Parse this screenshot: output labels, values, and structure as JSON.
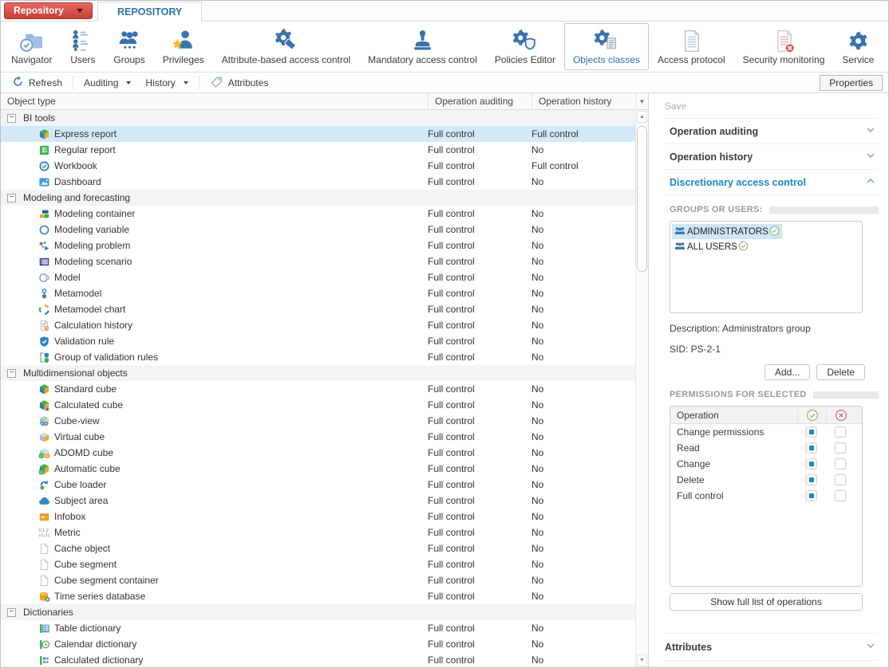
{
  "titlebar": {
    "app_menu": "Repository",
    "tab": "REPOSITORY"
  },
  "ribbon": {
    "items": [
      {
        "label": "Navigator",
        "icon": "navigator",
        "selected": false
      },
      {
        "label": "Users",
        "icon": "users",
        "selected": false
      },
      {
        "label": "Groups",
        "icon": "groups",
        "selected": false
      },
      {
        "label": "Privileges",
        "icon": "privileges",
        "selected": false
      },
      {
        "label": "Attribute-based access control",
        "icon": "abac",
        "selected": false
      },
      {
        "label": "Mandatory access control",
        "icon": "mac",
        "selected": false
      },
      {
        "label": "Policies Editor",
        "icon": "policies-editor",
        "selected": false
      },
      {
        "label": "Objects classes",
        "icon": "objects-classes",
        "selected": true
      },
      {
        "label": "Access protocol",
        "icon": "access-protocol",
        "selected": false
      },
      {
        "label": "Security monitoring",
        "icon": "security-monitoring",
        "selected": false
      },
      {
        "label": "Service",
        "icon": "service",
        "selected": false
      }
    ]
  },
  "toolbar": {
    "refresh": "Refresh",
    "auditing": "Auditing",
    "history": "History",
    "attributes": "Attributes",
    "properties": "Properties"
  },
  "table": {
    "columns": [
      "Object type",
      "Operation auditing",
      "Operation history"
    ],
    "rows": [
      {
        "type": "group",
        "label": "BI tools"
      },
      {
        "type": "item",
        "icon": "express-report",
        "label": "Express report",
        "auditing": "Full control",
        "history": "Full control",
        "selected": true
      },
      {
        "type": "item",
        "icon": "regular-report",
        "label": "Regular report",
        "auditing": "Full control",
        "history": "No"
      },
      {
        "type": "item",
        "icon": "workbook",
        "label": "Workbook",
        "auditing": "Full control",
        "history": "Full control"
      },
      {
        "type": "item",
        "icon": "dashboard",
        "label": "Dashboard",
        "auditing": "Full control",
        "history": "No"
      },
      {
        "type": "group",
        "label": "Modeling and forecasting"
      },
      {
        "type": "item",
        "icon": "modeling-container",
        "label": "Modeling container",
        "auditing": "Full control",
        "history": "No"
      },
      {
        "type": "item",
        "icon": "modeling-variable",
        "label": "Modeling variable",
        "auditing": "Full control",
        "history": "No"
      },
      {
        "type": "item",
        "icon": "modeling-problem",
        "label": "Modeling problem",
        "auditing": "Full control",
        "history": "No"
      },
      {
        "type": "item",
        "icon": "modeling-scenario",
        "label": "Modeling scenario",
        "auditing": "Full control",
        "history": "No"
      },
      {
        "type": "item",
        "icon": "model",
        "label": "Model",
        "auditing": "Full control",
        "history": "No"
      },
      {
        "type": "item",
        "icon": "metamodel",
        "label": "Metamodel",
        "auditing": "Full control",
        "history": "No"
      },
      {
        "type": "item",
        "icon": "metamodel-chart",
        "label": "Metamodel chart",
        "auditing": "Full control",
        "history": "No"
      },
      {
        "type": "item",
        "icon": "calculation-history",
        "label": "Calculation history",
        "auditing": "Full control",
        "history": "No"
      },
      {
        "type": "item",
        "icon": "validation-rule",
        "label": "Validation rule",
        "auditing": "Full control",
        "history": "No"
      },
      {
        "type": "item",
        "icon": "group-validation-rules",
        "label": "Group of validation rules",
        "auditing": "Full control",
        "history": "No"
      },
      {
        "type": "group",
        "label": "Multidimensional objects"
      },
      {
        "type": "item",
        "icon": "standard-cube",
        "label": "Standard cube",
        "auditing": "Full control",
        "history": "No"
      },
      {
        "type": "item",
        "icon": "calculated-cube",
        "label": "Calculated cube",
        "auditing": "Full control",
        "history": "No"
      },
      {
        "type": "item",
        "icon": "cube-view",
        "label": "Cube-view",
        "auditing": "Full control",
        "history": "No"
      },
      {
        "type": "item",
        "icon": "virtual-cube",
        "label": "Virtual cube",
        "auditing": "Full control",
        "history": "No"
      },
      {
        "type": "item",
        "icon": "adomd-cube",
        "label": "ADOMD cube",
        "auditing": "Full control",
        "history": "No"
      },
      {
        "type": "item",
        "icon": "automatic-cube",
        "label": "Automatic cube",
        "auditing": "Full control",
        "history": "No"
      },
      {
        "type": "item",
        "icon": "cube-loader",
        "label": "Cube loader",
        "auditing": "Full control",
        "history": "No"
      },
      {
        "type": "item",
        "icon": "subject-area",
        "label": "Subject area",
        "auditing": "Full control",
        "history": "No"
      },
      {
        "type": "item",
        "icon": "infobox",
        "label": "Infobox",
        "auditing": "Full control",
        "history": "No"
      },
      {
        "type": "item",
        "icon": "metric",
        "label": "Metric",
        "auditing": "Full control",
        "history": "No"
      },
      {
        "type": "item",
        "icon": "cache-object",
        "label": "Cache object",
        "auditing": "Full control",
        "history": "No"
      },
      {
        "type": "item",
        "icon": "cube-segment",
        "label": "Cube segment",
        "auditing": "Full control",
        "history": "No"
      },
      {
        "type": "item",
        "icon": "cube-segment-container",
        "label": "Cube segment container",
        "auditing": "Full control",
        "history": "No"
      },
      {
        "type": "item",
        "icon": "time-series-database",
        "label": "Time series database",
        "auditing": "Full control",
        "history": "No"
      },
      {
        "type": "group",
        "label": "Dictionaries"
      },
      {
        "type": "item",
        "icon": "table-dictionary",
        "label": "Table dictionary",
        "auditing": "Full control",
        "history": "No"
      },
      {
        "type": "item",
        "icon": "calendar-dictionary",
        "label": "Calendar dictionary",
        "auditing": "Full control",
        "history": "No"
      },
      {
        "type": "item",
        "icon": "calculated-dictionary",
        "label": "Calculated dictionary",
        "auditing": "Full control",
        "history": "No"
      }
    ]
  },
  "panel": {
    "save_label": "Save",
    "sections": [
      {
        "label": "Operation auditing",
        "expanded": false
      },
      {
        "label": "Operation history",
        "expanded": false
      },
      {
        "label": "Discretionary access control",
        "expanded": true
      }
    ],
    "groups_users": {
      "heading": "GROUPS OR USERS:",
      "items": [
        {
          "name": "ADMINISTRATORS",
          "checked": true,
          "selected": true
        },
        {
          "name": "ALL USERS",
          "checked": true,
          "selected": false
        }
      ],
      "description": "Description: Administrators group",
      "sid": "SID: PS-2-1",
      "add_label": "Add...",
      "delete_label": "Delete"
    },
    "permissions": {
      "heading": "PERMISSIONS FOR SELECTED",
      "operation_col": "Operation",
      "rows": [
        {
          "label": "Change permissions",
          "allow": true,
          "deny": false
        },
        {
          "label": "Read",
          "allow": true,
          "deny": false
        },
        {
          "label": "Change",
          "allow": true,
          "deny": false
        },
        {
          "label": "Delete",
          "allow": true,
          "deny": false
        },
        {
          "label": "Full control",
          "allow": true,
          "deny": false
        }
      ],
      "show_full_label": "Show full list of operations"
    },
    "attributes_label": "Attributes"
  },
  "colors": {
    "accent_blue": "#2e74ab",
    "section_blue": "#1f87c8",
    "selection_blue": "#d3e9f8",
    "button_red": "#c73f37",
    "checkbox_blue": "#1f87c9",
    "check_green": "#8fbf6f",
    "deny_red": "#d0716c"
  }
}
